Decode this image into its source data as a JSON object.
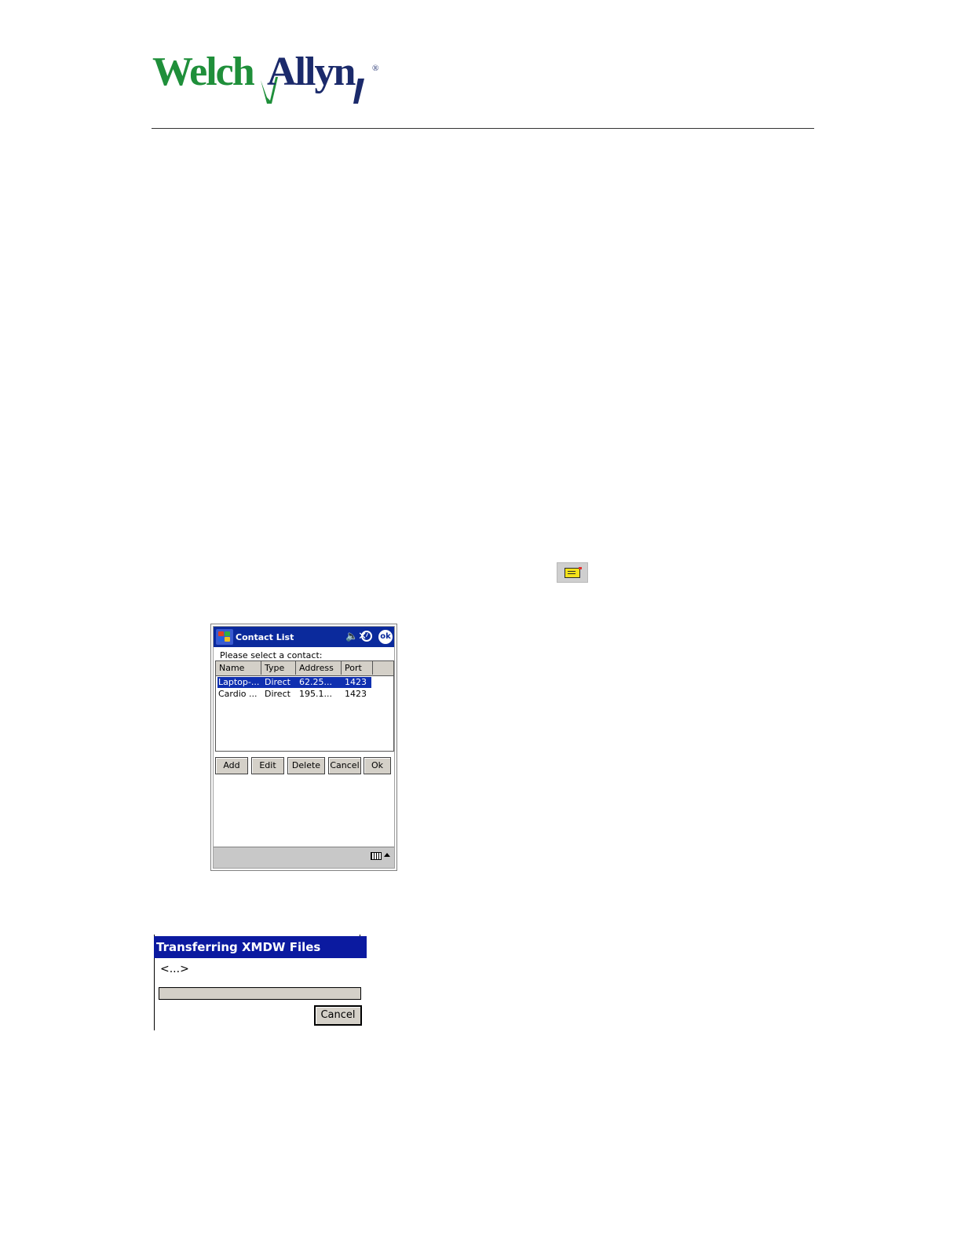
{
  "brand": {
    "logo_text": "WelchAllyn",
    "registered_mark": "®",
    "colors": {
      "welch": "#1f8f3a",
      "allyn": "#1b2a6b"
    }
  },
  "inline_icon": {
    "name": "send-icon",
    "color": "#f4e21a"
  },
  "contact_list": {
    "title": "Contact List",
    "ok_label": "ok",
    "prompt": "Please select a contact:",
    "columns": [
      "Name",
      "Type",
      "Address",
      "Port"
    ],
    "rows": [
      {
        "name": "Laptop-...",
        "type": "Direct",
        "address": "62.25...",
        "port": "1423",
        "selected": true
      },
      {
        "name": "Cardio ...",
        "type": "Direct",
        "address": "195.1...",
        "port": "1423",
        "selected": false
      }
    ],
    "buttons": {
      "add": "Add",
      "edit": "Edit",
      "delete": "Delete",
      "cancel": "Cancel",
      "ok": "Ok"
    },
    "titlebar_color": "#0b2a9c"
  },
  "transfer_dialog": {
    "title": "Transferring XMDW Files",
    "status": "<...>",
    "progress": 0,
    "cancel_label": "Cancel",
    "titlebar_color": "#0b1aa0"
  }
}
